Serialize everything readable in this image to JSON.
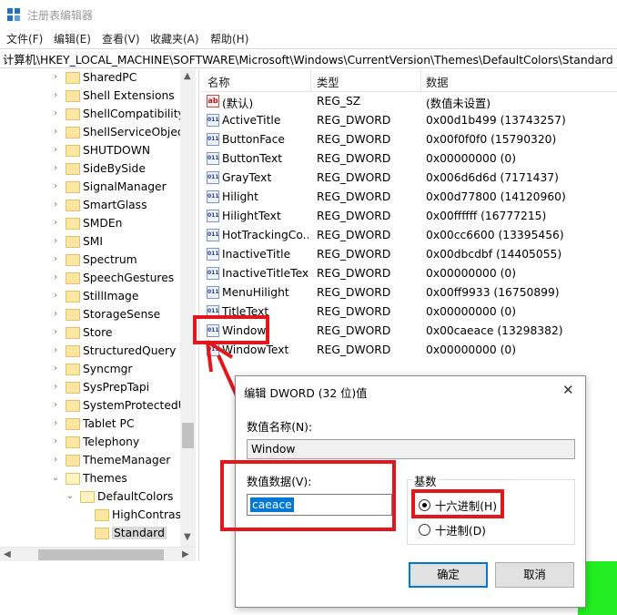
{
  "window": {
    "title": "注册表编辑器"
  },
  "menu": [
    "文件(F)",
    "编辑(E)",
    "查看(V)",
    "收藏夹(A)",
    "帮助(H)"
  ],
  "address": "计算机\\HKEY_LOCAL_MACHINE\\SOFTWARE\\Microsoft\\Windows\\CurrentVersion\\Themes\\DefaultColors\\Standard",
  "tree": [
    {
      "name": "SharedPC",
      "state": "collapsed"
    },
    {
      "name": "Shell Extensions",
      "state": "collapsed"
    },
    {
      "name": "ShellCompatibility",
      "state": "collapsed"
    },
    {
      "name": "ShellServiceObject",
      "state": "collapsed"
    },
    {
      "name": "SHUTDOWN",
      "state": "collapsed"
    },
    {
      "name": "SideBySide",
      "state": "collapsed"
    },
    {
      "name": "SignalManager",
      "state": "collapsed"
    },
    {
      "name": "SmartGlass",
      "state": "collapsed"
    },
    {
      "name": "SMDEn",
      "state": "collapsed"
    },
    {
      "name": "SMI",
      "state": "collapsed"
    },
    {
      "name": "Spectrum",
      "state": "collapsed"
    },
    {
      "name": "SpeechGestures",
      "state": "collapsed"
    },
    {
      "name": "StillImage",
      "state": "collapsed"
    },
    {
      "name": "StorageSense",
      "state": "collapsed"
    },
    {
      "name": "Store",
      "state": "collapsed"
    },
    {
      "name": "StructuredQuery",
      "state": "collapsed"
    },
    {
      "name": "Syncmgr",
      "state": "collapsed"
    },
    {
      "name": "SysPrepTapi",
      "state": "collapsed"
    },
    {
      "name": "SystemProtectedU",
      "state": "collapsed"
    },
    {
      "name": "Tablet PC",
      "state": "collapsed"
    },
    {
      "name": "Telephony",
      "state": "collapsed"
    },
    {
      "name": "ThemeManager",
      "state": "collapsed"
    },
    {
      "name": "Themes",
      "state": "expanded"
    },
    {
      "name": "DefaultColors",
      "state": "expanded"
    },
    {
      "name": "HighContrast",
      "state": "leaf"
    },
    {
      "name": "Standard",
      "state": "selected"
    }
  ],
  "list": {
    "headers": {
      "name": "名称",
      "type": "类型",
      "data": "数据"
    },
    "rows": [
      {
        "name": "(默认)",
        "type": "REG_SZ",
        "data": "(数值未设置)",
        "icon": "string-value-icon"
      },
      {
        "name": "ActiveTitle",
        "type": "REG_DWORD",
        "data": "0x00d1b499 (13743257)",
        "icon": "binary-value-icon"
      },
      {
        "name": "ButtonFace",
        "type": "REG_DWORD",
        "data": "0x00f0f0f0 (15790320)",
        "icon": "binary-value-icon"
      },
      {
        "name": "ButtonText",
        "type": "REG_DWORD",
        "data": "0x00000000 (0)",
        "icon": "binary-value-icon"
      },
      {
        "name": "GrayText",
        "type": "REG_DWORD",
        "data": "0x006d6d6d (7171437)",
        "icon": "binary-value-icon"
      },
      {
        "name": "Hilight",
        "type": "REG_DWORD",
        "data": "0x00d77800 (14120960)",
        "icon": "binary-value-icon"
      },
      {
        "name": "HilightText",
        "type": "REG_DWORD",
        "data": "0x00ffffff (16777215)",
        "icon": "binary-value-icon"
      },
      {
        "name": "HotTrackingCo...",
        "type": "REG_DWORD",
        "data": "0x00cc6600 (13395456)",
        "icon": "binary-value-icon"
      },
      {
        "name": "InactiveTitle",
        "type": "REG_DWORD",
        "data": "0x00dbcdbf (14405055)",
        "icon": "binary-value-icon"
      },
      {
        "name": "InactiveTitleText",
        "type": "REG_DWORD",
        "data": "0x00000000 (0)",
        "icon": "binary-value-icon"
      },
      {
        "name": "MenuHilight",
        "type": "REG_DWORD",
        "data": "0x00ff9933 (16750899)",
        "icon": "binary-value-icon"
      },
      {
        "name": "TitleText",
        "type": "REG_DWORD",
        "data": "0x00000000 (0)",
        "icon": "binary-value-icon"
      },
      {
        "name": "Window",
        "type": "REG_DWORD",
        "data": "0x00caeace (13298382)",
        "icon": "binary-value-icon"
      },
      {
        "name": "WindowText",
        "type": "REG_DWORD",
        "data": "0x00000000 (0)",
        "icon": "binary-value-icon"
      }
    ]
  },
  "dialog": {
    "title": "编辑 DWORD (32 位)值",
    "value_name_label": "数值名称(N):",
    "value_name": "Window",
    "value_data_label": "数值数据(V):",
    "value_data": "caeace",
    "base_label": "基数",
    "hex_label": "十六进制(H)",
    "dec_label": "十进制(D)",
    "selected_base": "hex",
    "ok_label": "确定",
    "cancel_label": "取消"
  },
  "colors": {
    "annotation_red": "#e3161b",
    "selection_blue": "#0078d7",
    "green_background": "#22ee22"
  }
}
